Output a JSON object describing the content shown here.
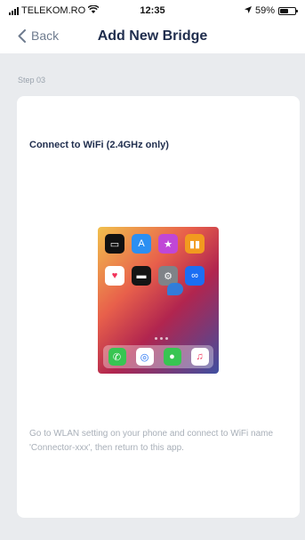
{
  "status_bar": {
    "carrier": "TELEKOM.RO",
    "time": "12:35",
    "battery": "59%",
    "battery_level": 0.59
  },
  "nav": {
    "back_label": "Back",
    "title": "Add New Bridge"
  },
  "step_label": "Step 03",
  "card": {
    "heading": "Connect to WiFi (2.4GHz only)",
    "description": "Go to WLAN setting on your phone and connect to WiFi name 'Connector-xxx', then return to this app."
  },
  "illustration": {
    "apps_row1": [
      "tv-icon",
      "app-store-icon",
      "star-icon",
      "books-icon"
    ],
    "apps_row2": [
      "health-icon",
      "wallet-icon",
      "settings-icon",
      "shortcuts-icon"
    ],
    "dock": [
      "phone-icon",
      "safari-icon",
      "messages-icon",
      "music-icon"
    ]
  },
  "colors": {
    "title": "#1f2d4d",
    "back": "#6f7c8f",
    "background": "#e9ebee",
    "card": "#ffffff",
    "description": "#a8afb8"
  }
}
